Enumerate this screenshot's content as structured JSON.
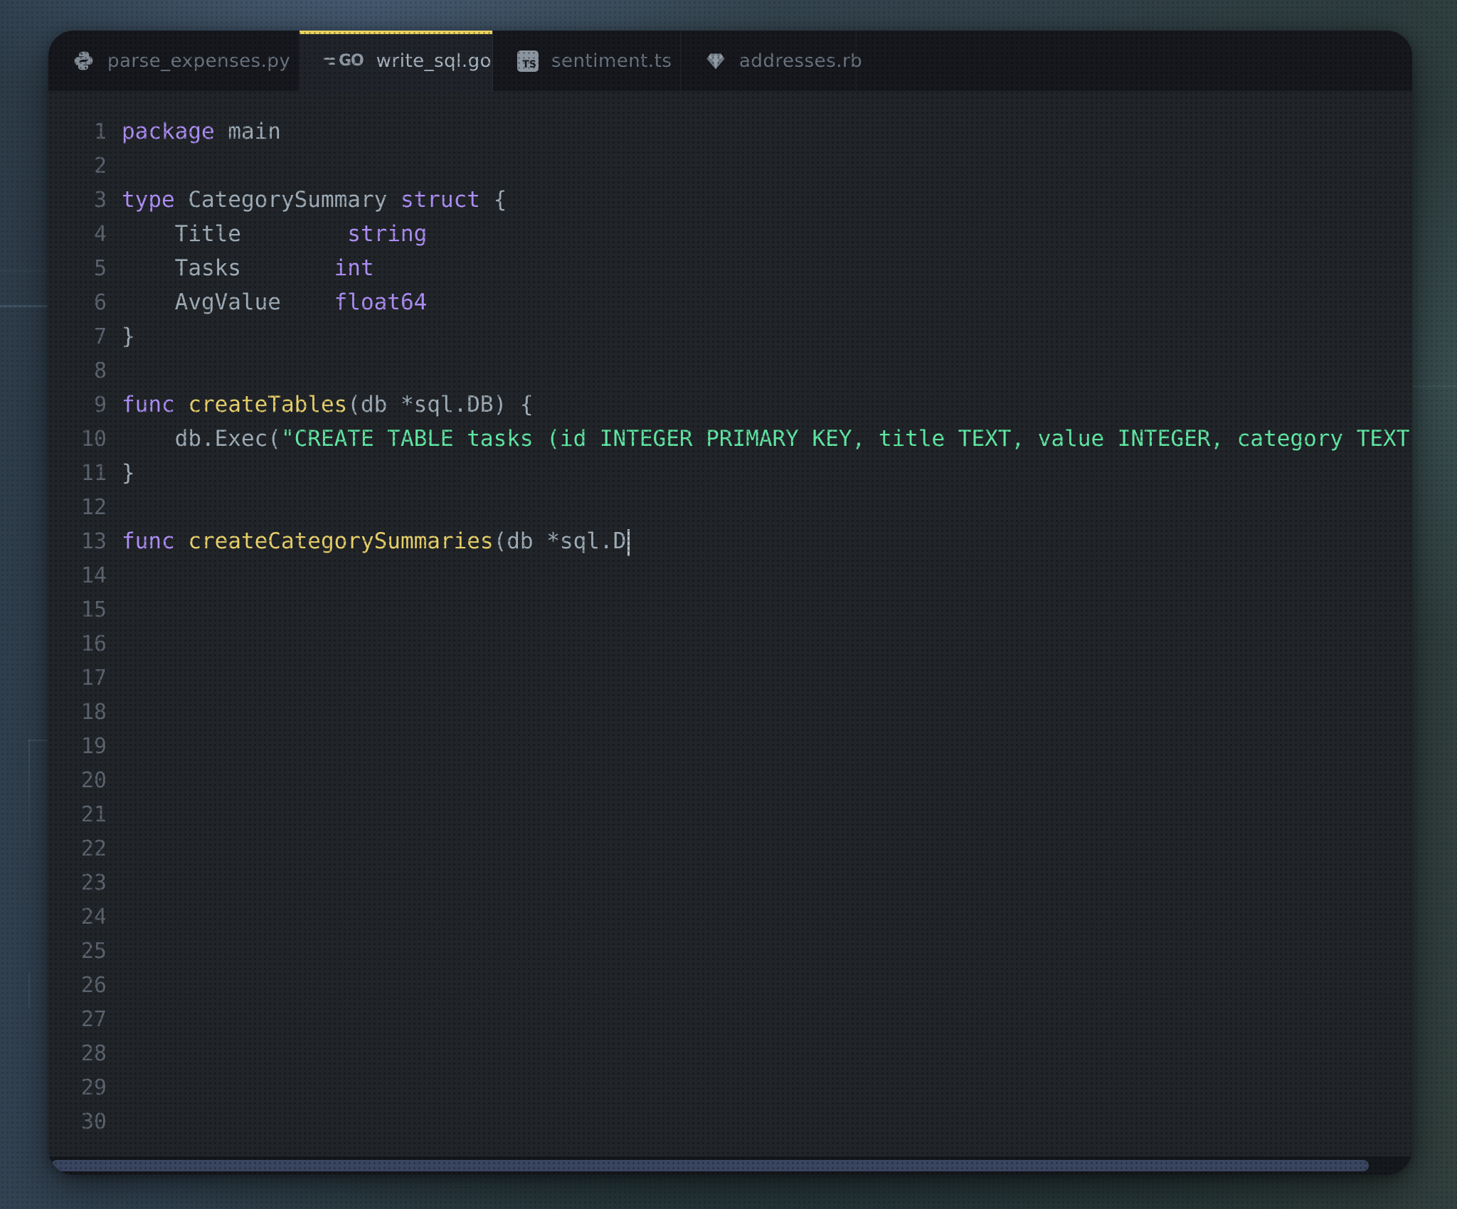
{
  "colors": {
    "accent_tab": "#ecd35f",
    "keyword": "#ab8df2",
    "function": "#e6cf6b",
    "string": "#5fe5a2",
    "text": "#9dabb6",
    "line_number": "#5a626d",
    "window_bg": "#212428",
    "tabbar_bg": "#16181d",
    "scroll_thumb": "#39445f"
  },
  "tabs": [
    {
      "label": "parse_expenses.py",
      "icon": "python-icon",
      "active": false
    },
    {
      "label": "write_sql.go",
      "icon": "go-icon",
      "active": true
    },
    {
      "label": "sentiment.ts",
      "icon": "typescript-icon",
      "active": false
    },
    {
      "label": "addresses.rb",
      "icon": "ruby-icon",
      "active": false
    }
  ],
  "icons": {
    "ts_badge": "TS"
  },
  "editor": {
    "language": "go",
    "lines": [
      {
        "n": "1",
        "segs": [
          [
            "kw",
            "package"
          ],
          [
            "def",
            " main"
          ]
        ]
      },
      {
        "n": "2",
        "segs": []
      },
      {
        "n": "3",
        "segs": [
          [
            "kw",
            "type"
          ],
          [
            "def",
            " CategorySummary "
          ],
          [
            "kw",
            "struct"
          ],
          [
            "def",
            " {"
          ]
        ]
      },
      {
        "n": "4",
        "segs": [
          [
            "def",
            "    Title        "
          ],
          [
            "kw",
            "string"
          ]
        ]
      },
      {
        "n": "5",
        "segs": [
          [
            "def",
            "    Tasks       "
          ],
          [
            "kw",
            "int"
          ]
        ]
      },
      {
        "n": "6",
        "segs": [
          [
            "def",
            "    AvgValue    "
          ],
          [
            "kw",
            "float64"
          ]
        ]
      },
      {
        "n": "7",
        "segs": [
          [
            "def",
            "}"
          ]
        ]
      },
      {
        "n": "8",
        "segs": []
      },
      {
        "n": "9",
        "segs": [
          [
            "kw",
            "func"
          ],
          [
            "def",
            " "
          ],
          [
            "fn",
            "createTables"
          ],
          [
            "def",
            "(db *sql.DB) {"
          ]
        ]
      },
      {
        "n": "10",
        "segs": [
          [
            "def",
            "    db.Exec("
          ],
          [
            "str",
            "\"CREATE TABLE tasks (id INTEGER PRIMARY KEY, title TEXT, value INTEGER, category TEXT"
          ]
        ]
      },
      {
        "n": "11",
        "segs": [
          [
            "def",
            "}"
          ]
        ]
      },
      {
        "n": "12",
        "segs": []
      },
      {
        "n": "13",
        "segs": [
          [
            "kw",
            "func"
          ],
          [
            "def",
            " "
          ],
          [
            "fn",
            "createCategorySummaries"
          ],
          [
            "def",
            "(db *sql.D"
          ],
          [
            "cursor",
            ""
          ]
        ]
      },
      {
        "n": "14",
        "segs": []
      },
      {
        "n": "15",
        "segs": []
      },
      {
        "n": "16",
        "segs": []
      },
      {
        "n": "17",
        "segs": []
      },
      {
        "n": "18",
        "segs": []
      },
      {
        "n": "19",
        "segs": []
      },
      {
        "n": "20",
        "segs": []
      },
      {
        "n": "21",
        "segs": []
      },
      {
        "n": "22",
        "segs": []
      },
      {
        "n": "23",
        "segs": []
      },
      {
        "n": "24",
        "segs": []
      },
      {
        "n": "25",
        "segs": []
      },
      {
        "n": "26",
        "segs": []
      },
      {
        "n": "27",
        "segs": []
      },
      {
        "n": "28",
        "segs": []
      },
      {
        "n": "29",
        "segs": []
      },
      {
        "n": "30",
        "segs": []
      }
    ]
  }
}
